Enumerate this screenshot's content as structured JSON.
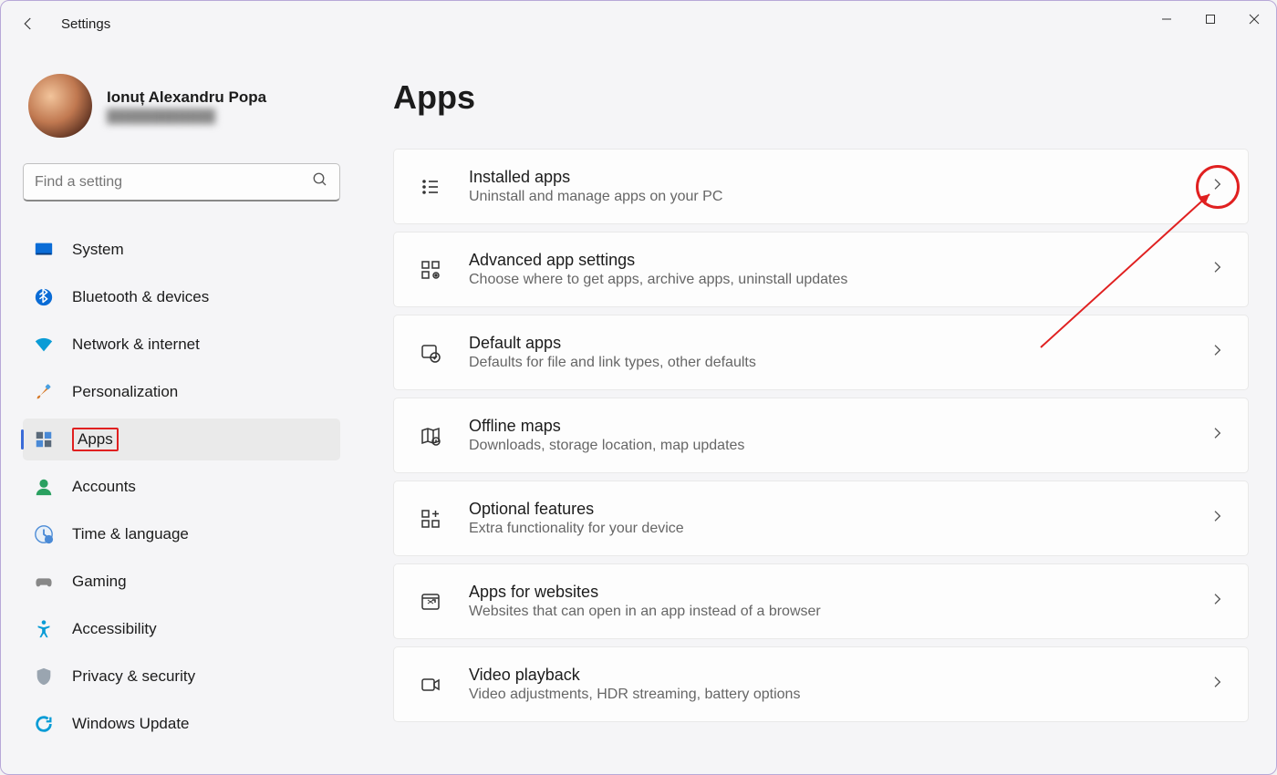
{
  "window": {
    "title": "Settings"
  },
  "profile": {
    "name": "Ionuț Alexandru Popa",
    "email_placeholder": "████████████"
  },
  "search": {
    "placeholder": "Find a setting"
  },
  "nav": {
    "items": [
      {
        "label": "System",
        "icon": "monitor"
      },
      {
        "label": "Bluetooth & devices",
        "icon": "bluetooth"
      },
      {
        "label": "Network & internet",
        "icon": "wifi"
      },
      {
        "label": "Personalization",
        "icon": "brush"
      },
      {
        "label": "Apps",
        "icon": "grid",
        "active": true
      },
      {
        "label": "Accounts",
        "icon": "person"
      },
      {
        "label": "Time & language",
        "icon": "clock"
      },
      {
        "label": "Gaming",
        "icon": "gamepad"
      },
      {
        "label": "Accessibility",
        "icon": "accessibility"
      },
      {
        "label": "Privacy & security",
        "icon": "shield"
      },
      {
        "label": "Windows Update",
        "icon": "update"
      }
    ]
  },
  "main": {
    "heading": "Apps",
    "cards": [
      {
        "icon": "list",
        "title": "Installed apps",
        "desc": "Uninstall and manage apps on your PC"
      },
      {
        "icon": "grid-gear",
        "title": "Advanced app settings",
        "desc": "Choose where to get apps, archive apps, uninstall updates"
      },
      {
        "icon": "window-check",
        "title": "Default apps",
        "desc": "Defaults for file and link types, other defaults"
      },
      {
        "icon": "map",
        "title": "Offline maps",
        "desc": "Downloads, storage location, map updates"
      },
      {
        "icon": "grid-plus",
        "title": "Optional features",
        "desc": "Extra functionality for your device"
      },
      {
        "icon": "window-link",
        "title": "Apps for websites",
        "desc": "Websites that can open in an app instead of a browser"
      },
      {
        "icon": "video",
        "title": "Video playback",
        "desc": "Video adjustments, HDR streaming, battery options"
      }
    ]
  }
}
